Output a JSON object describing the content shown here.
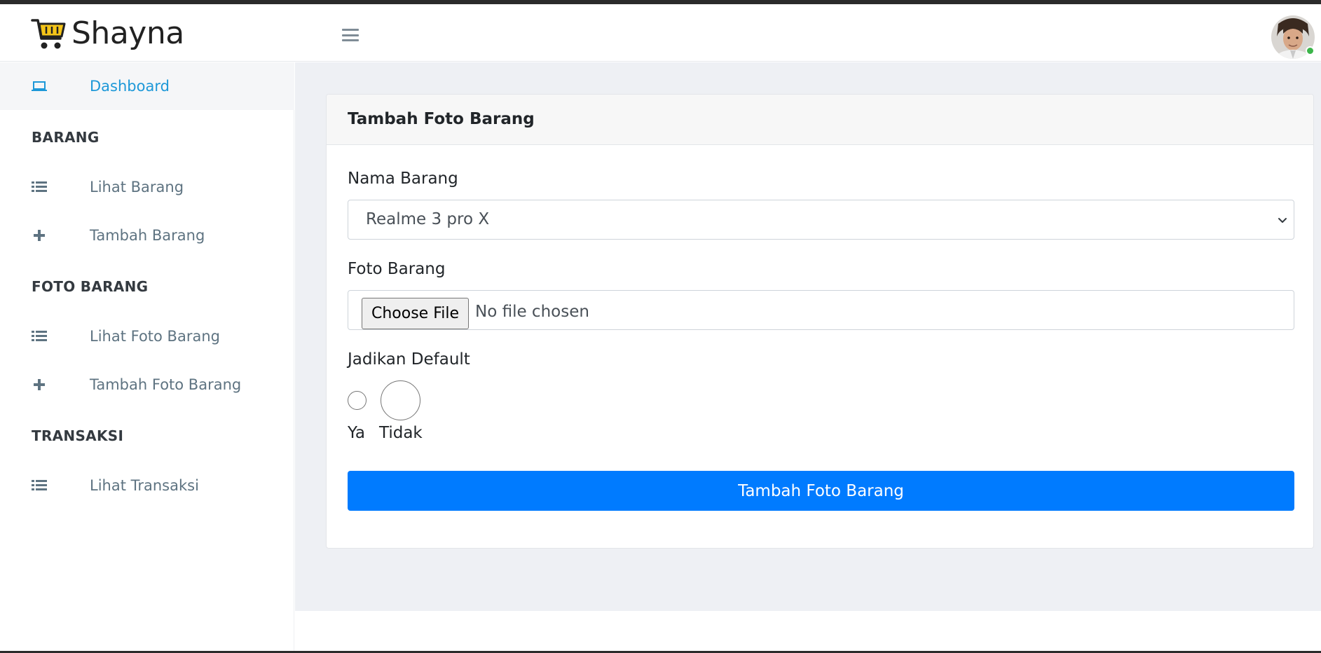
{
  "brand": {
    "name": "Shayna",
    "icon": "shopping-cart-icon",
    "icon_color": "#f5c518"
  },
  "header": {
    "menu_icon": "hamburger-icon",
    "avatar_icon": "user-avatar",
    "status_color": "#3bb54a"
  },
  "sidebar": {
    "dashboard": {
      "label": "Dashboard",
      "icon": "laptop-icon",
      "color": "#1d98d8"
    },
    "sections": [
      {
        "heading": "BARANG",
        "items": [
          {
            "label": "Lihat Barang",
            "icon": "list-icon"
          },
          {
            "label": "Tambah Barang",
            "icon": "plus-icon"
          }
        ]
      },
      {
        "heading": "FOTO BARANG",
        "items": [
          {
            "label": "Lihat Foto Barang",
            "icon": "list-icon"
          },
          {
            "label": "Tambah Foto Barang",
            "icon": "plus-icon"
          }
        ]
      },
      {
        "heading": "TRANSAKSI",
        "items": [
          {
            "label": "Lihat Transaksi",
            "icon": "list-icon"
          }
        ]
      }
    ]
  },
  "form": {
    "title": "Tambah Foto Barang",
    "nama_barang_label": "Nama Barang",
    "nama_barang_value": "Realme 3 pro X",
    "foto_barang_label": "Foto Barang",
    "file_button": "Choose File",
    "file_status": "No file chosen",
    "default_label": "Jadikan Default",
    "option_ya": "Ya",
    "option_tidak": "Tidak",
    "submit_label": "Tambah Foto Barang",
    "submit_color": "#007bff"
  }
}
